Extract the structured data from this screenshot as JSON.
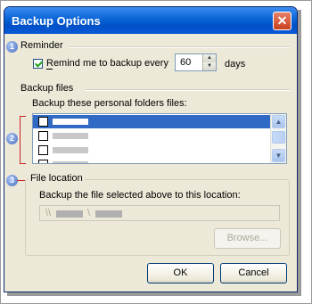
{
  "window": {
    "title": "Backup Options",
    "close_glyph": "✕"
  },
  "callouts": [
    "1",
    "2",
    "3"
  ],
  "reminder": {
    "group_label": "Reminder",
    "checkbox_label": "Remind me to backup every",
    "checked": true,
    "days_value": "60",
    "days_unit": "days"
  },
  "backup_files": {
    "group_label": "Backup files",
    "list_label": "Backup these personal folders files:",
    "rows": [
      {
        "selected": true
      },
      {
        "selected": false
      },
      {
        "selected": false
      },
      {
        "selected": false
      }
    ]
  },
  "file_location": {
    "group_label": "File location",
    "description": "Backup the file selected above to this location:",
    "path_prefix": "\\\\",
    "path_separator": "\\",
    "browse_label": "Browse..."
  },
  "buttons": {
    "ok": "OK",
    "cancel": "Cancel"
  },
  "colors": {
    "title_bar": "#0a5ad8",
    "selection": "#316ac5",
    "callout_red": "#cc2222"
  },
  "icons": {
    "close": "close-icon",
    "spin_up": "spin-up-icon",
    "spin_down": "spin-down-icon",
    "scroll_up": "scroll-up-icon",
    "scroll_down": "scroll-down-icon"
  }
}
